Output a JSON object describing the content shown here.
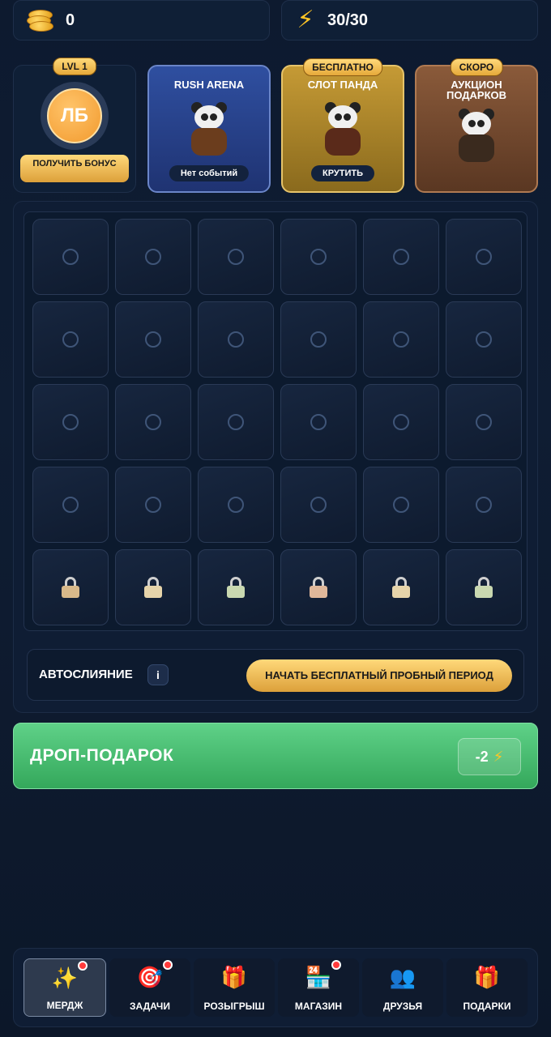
{
  "topbar": {
    "coins": "0",
    "energy": "30/30"
  },
  "cards": {
    "level": {
      "badge": "LVL 1",
      "avatar_initials": "ЛБ",
      "button": "ПОЛУЧИТЬ БОНУС"
    },
    "rush": {
      "title": "RUSH ARENA",
      "pill": "Нет событий"
    },
    "slot": {
      "badge": "БЕСПЛАТНО",
      "title": "СЛОТ ПАНДА",
      "pill": "КРУТИТЬ"
    },
    "auction": {
      "badge": "СКОРО",
      "title": "АУКЦИОН ПОДАРКОВ"
    }
  },
  "grid": {
    "rows": 5,
    "cols": 6,
    "locked_rows": 1
  },
  "autorow": {
    "label": "АВТОСЛИЯНИЕ",
    "info": "i",
    "button": "НАЧАТЬ БЕСПЛАТНЫЙ ПРОБНЫЙ ПЕРИОД"
  },
  "drop": {
    "label": "ДРОП-ПОДАРОК",
    "cost": "-2"
  },
  "nav": {
    "items": [
      {
        "label": "МЕРДЖ",
        "icon": "✨",
        "dot": true,
        "active": true
      },
      {
        "label": "ЗАДАЧИ",
        "icon": "🎯",
        "dot": true,
        "active": false
      },
      {
        "label": "РОЗЫГРЫШ",
        "icon": "🎁",
        "dot": false,
        "active": false
      },
      {
        "label": "МАГАЗИН",
        "icon": "🏪",
        "dot": true,
        "active": false
      },
      {
        "label": "ДРУЗЬЯ",
        "icon": "👥",
        "dot": false,
        "active": false
      },
      {
        "label": "ПОДАРКИ",
        "icon": "🎁",
        "dot": false,
        "active": false
      }
    ]
  },
  "colors": {
    "accent_gold": "#ffd97a",
    "drop_green": "#4cc476",
    "notify_red": "#ff3b3b"
  }
}
